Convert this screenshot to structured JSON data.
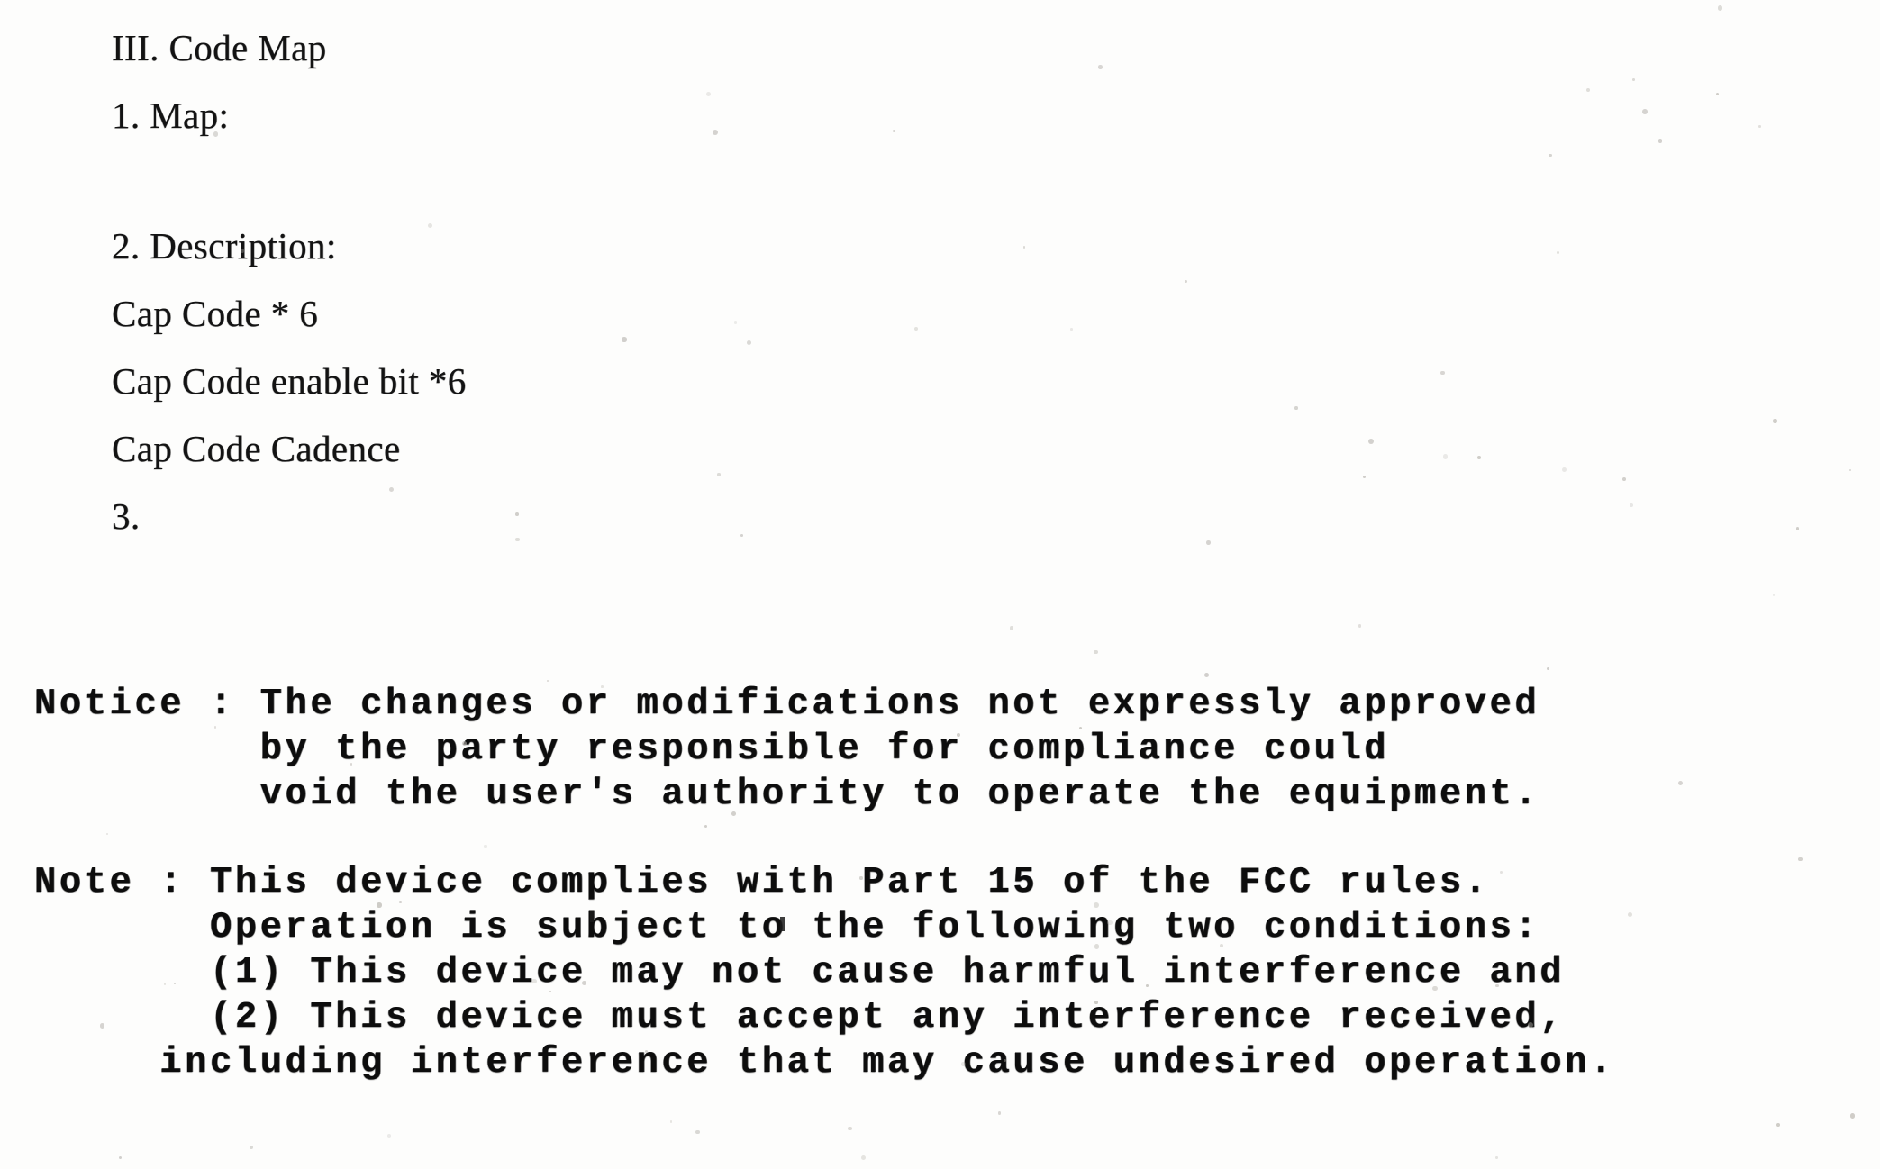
{
  "document": {
    "section_heading": "III. Code Map",
    "serif_lines": [
      {
        "text": "III. Code Map",
        "gap_before": false
      },
      {
        "text": "1. Map:",
        "gap_before": false
      },
      {
        "text": "2. Description:",
        "gap_before": true
      },
      {
        "text": "Cap Code * 6",
        "gap_before": false
      },
      {
        "text": "Cap Code enable bit *6",
        "gap_before": false
      },
      {
        "text": "Cap Code Cadence",
        "gap_before": false
      },
      {
        "text": "3.",
        "gap_before": false
      }
    ],
    "notice": {
      "label": "Notice :",
      "lines": [
        "Notice : The changes or modifications not expressly approved",
        "         by the party responsible for compliance could",
        "         void the user's authority to operate the equipment."
      ]
    },
    "note": {
      "label": "Note :",
      "lines": [
        "Note : This device complies with Part 15 of the FCC rules.",
        "       Operation is subject to the following two conditions:",
        "       (1) This device may not cause harmful interference and",
        "       (2) This device must accept any interference received,",
        "     including interference that may cause undesired operation."
      ]
    },
    "colors": {
      "ink": "#131313",
      "paper": "#fdfdfc"
    }
  }
}
